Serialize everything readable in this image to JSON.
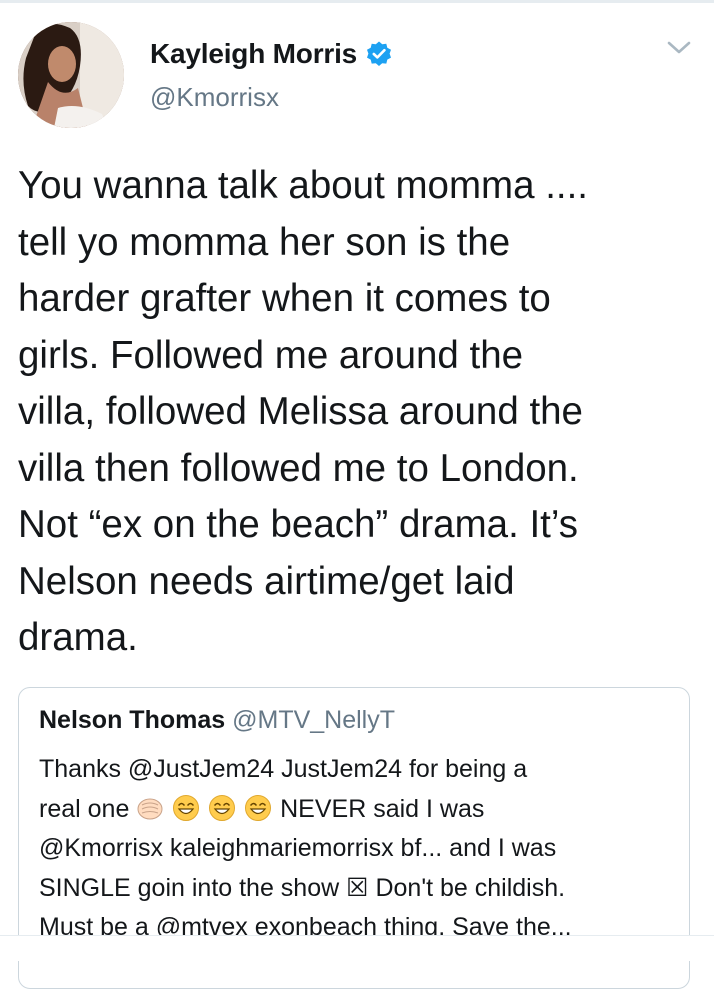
{
  "author": {
    "name": "Kayleigh Morris",
    "handle": "@Kmorrisx",
    "verified": true
  },
  "tweet": {
    "text": "You wanna talk about momma ....\ntell yo momma her son is the\nharder grafter when it comes to\ngirls. Followed me around the\nvilla, followed Melissa around the\nvilla then followed me to London.\nNot “ex on the beach” drama. It’s\nNelson needs airtime/get laid\ndrama."
  },
  "quoted_tweet": {
    "name": "Nelson Thomas",
    "handle": "@MTV_NellyT",
    "line1": "Thanks @JustJem24 JustJem24 for being a",
    "line2_start": "real one",
    "line2_end": "NEVER said I was",
    "line3": "@Kmorrisx kaleighmariemorrisx bf... and I was",
    "line4": "SINGLE goin into the show ☒ Don't be childish.",
    "line5": "Must be a @mtvex exonbeach thing. Save the..."
  },
  "icons": {
    "verified": "verified-badge-icon",
    "menu": "chevron-down-icon",
    "emojis": [
      "fist-bump-emoji",
      "grinning-emoji",
      "grinning-emoji",
      "grinning-emoji"
    ]
  },
  "colors": {
    "text": "#14171a",
    "secondary": "#657786",
    "verified": "#1da1f2",
    "border": "#ccd6dd",
    "emoji": "#ffcc4d"
  }
}
